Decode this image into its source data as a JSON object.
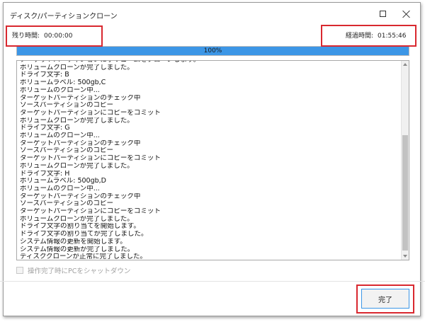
{
  "window": {
    "title": "ディスク/パーティションクローン",
    "maximize_icon": "maximize-icon",
    "close_icon": "close-icon"
  },
  "status": {
    "remaining_label": "残り時間:",
    "remaining_value": "00:00:00",
    "elapsed_label": "経過時間:",
    "elapsed_value": "01:55:46"
  },
  "progress": {
    "percent": 100,
    "label": "100%",
    "fill_color": "#3c96e6"
  },
  "log": {
    "lines": [
      "ターゲットパーティションにポリュームをクローンします。",
      "ボリュームクローンが完了しました。",
      "ドライブ文字: B",
      "ボリュームラベル: 500gb,C",
      "ボリュームのクローン中...",
      "ターゲットパーティションのチェック中",
      "ソースパーティションのコピー",
      "ターゲットパーティションにコピーをコミット",
      "ボリュームクローンが完了しました。",
      "ドライブ文字: G",
      "ボリュームのクローン中...",
      "ターゲットパーティションのチェック中",
      "ソースパーティションのコピー",
      "ターゲットパーティションにコピーをコミット",
      "ボリュームクローンが完了しました。",
      "ドライブ文字: H",
      "ボリュームラベル: 500gb,D",
      "ボリュームのクローン中...",
      "ターゲットパーティションのチェック中",
      "ソースパーティションのコピー",
      "ターゲットパーティションにコピーをコミット",
      "ボリュームクローンが完了しました。",
      "ドライブ文字の割り当てを開始します。",
      "ドライブ文字の割り当てが完了しました。",
      "システム情報の更新を開始します。",
      "システム情報の更新が完了しました。",
      "ディスククローンが正常に完了しました。"
    ]
  },
  "options": {
    "shutdown_label": "操作完了時にPCをシャットダウン",
    "shutdown_checked": false
  },
  "actions": {
    "done_label": "完了"
  },
  "colors": {
    "highlight": "#d9282f",
    "accent": "#3c96e6"
  }
}
